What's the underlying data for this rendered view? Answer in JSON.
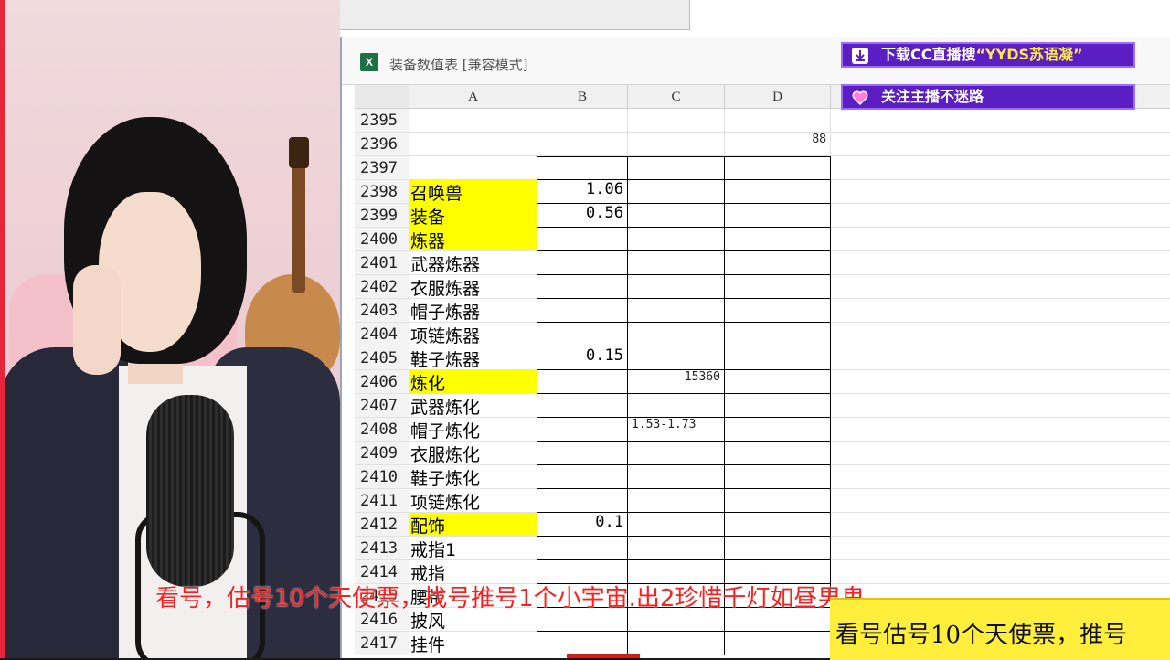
{
  "window": {
    "doc_title": "装备数值表  [兼容模式]",
    "excel_icon": "excel-file-icon"
  },
  "columns": [
    "A",
    "B",
    "C",
    "D"
  ],
  "rows": [
    {
      "num": "2395",
      "a": "",
      "b": "",
      "c": "",
      "d": "",
      "yellow": false
    },
    {
      "num": "2396",
      "a": "",
      "b": "",
      "c": "",
      "d": "88",
      "yellow": false
    },
    {
      "num": "2397",
      "a": "",
      "b": "",
      "c": "",
      "d": "",
      "yellow": false
    },
    {
      "num": "2398",
      "a": "召唤兽",
      "b": "1.06",
      "c": "",
      "d": "",
      "yellow": true
    },
    {
      "num": "2399",
      "a": "装备",
      "b": "0.56",
      "c": "",
      "d": "",
      "yellow": true
    },
    {
      "num": "2400",
      "a": "炼器",
      "b": "",
      "c": "",
      "d": "",
      "yellow": true
    },
    {
      "num": "2401",
      "a": "武器炼器",
      "b": "",
      "c": "",
      "d": "",
      "yellow": false
    },
    {
      "num": "2402",
      "a": "衣服炼器",
      "b": "",
      "c": "",
      "d": "",
      "yellow": false
    },
    {
      "num": "2403",
      "a": "帽子炼器",
      "b": "",
      "c": "",
      "d": "",
      "yellow": false
    },
    {
      "num": "2404",
      "a": "项链炼器",
      "b": "",
      "c": "",
      "d": "",
      "yellow": false
    },
    {
      "num": "2405",
      "a": "鞋子炼器",
      "b": "0.15",
      "c": "",
      "d": "",
      "yellow": false
    },
    {
      "num": "2406",
      "a": "炼化",
      "b": "",
      "c": "15360",
      "d": "",
      "yellow": true
    },
    {
      "num": "2407",
      "a": "武器炼化",
      "b": "",
      "c": "",
      "d": "",
      "yellow": false
    },
    {
      "num": "2408",
      "a": "帽子炼化",
      "b": "",
      "c": "1.53-1.73",
      "d": "",
      "yellow": false
    },
    {
      "num": "2409",
      "a": "衣服炼化",
      "b": "",
      "c": "",
      "d": "",
      "yellow": false
    },
    {
      "num": "2410",
      "a": "鞋子炼化",
      "b": "",
      "c": "",
      "d": "",
      "yellow": false
    },
    {
      "num": "2411",
      "a": "项链炼化",
      "b": "",
      "c": "",
      "d": "",
      "yellow": false
    },
    {
      "num": "2412",
      "a": "配饰",
      "b": "0.1",
      "c": "",
      "d": "",
      "yellow": true
    },
    {
      "num": "2413",
      "a": "戒指1",
      "b": "",
      "c": "",
      "d": "",
      "yellow": false
    },
    {
      "num": "2414",
      "a": "戒指",
      "b": "",
      "c": "",
      "d": "",
      "yellow": false
    },
    {
      "num": "2415",
      "a": "腰带",
      "b": "",
      "c": "",
      "d": "",
      "yellow": false
    },
    {
      "num": "2416",
      "a": "披风",
      "b": "",
      "c": "",
      "d": "",
      "yellow": false
    },
    {
      "num": "2417",
      "a": "挂件",
      "b": "",
      "c": "",
      "d": "",
      "yellow": false
    }
  ],
  "overlays": {
    "banner_download_prefix": "下载CC直播搜",
    "banner_download_highlight": "“YYDS苏语凝”",
    "banner_follow": "关注主播不迷路",
    "caption": "看号，估号10个天使票，找号推号1个小宇宙.出2珍惜千灯如昼男鬼",
    "ticker": "看号估号10个天使票，推号"
  },
  "colors": {
    "highlight_yellow": "#ffff00",
    "banner_purple": "#5a1ec2",
    "caption_red": "#ff1e1e",
    "ticker_yellow": "#ffee3c"
  }
}
